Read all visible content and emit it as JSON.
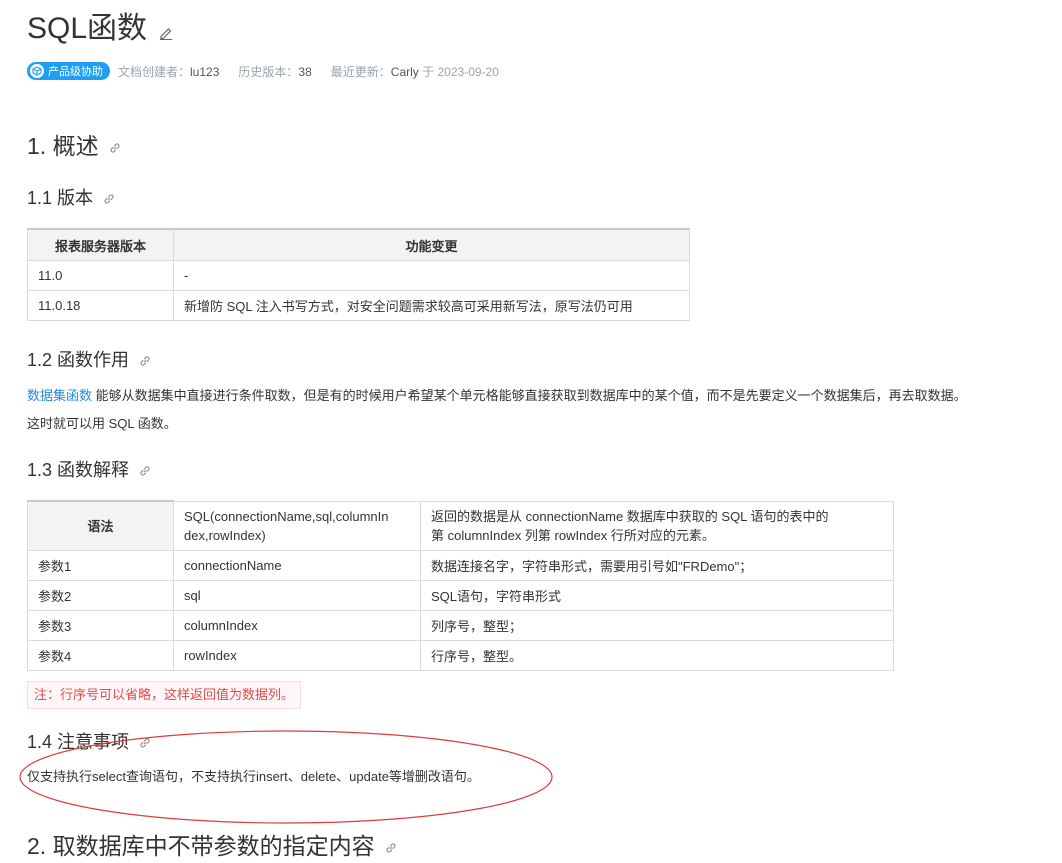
{
  "title": "SQL函数",
  "meta": {
    "badge": "产品级协助",
    "creator_label": "文档创建者：",
    "creator": "lu123",
    "versions_label": "历史版本：",
    "versions": "38",
    "updated_label": "最近更新：",
    "updated_by": "Carly",
    "updated_on_prefix": "于",
    "updated_on": "2023-09-20"
  },
  "sections": {
    "s1": "1. 概述",
    "s1_1": "1.1 版本",
    "s1_2": "1.2 函数作用",
    "s1_3": "1.3 函数解释",
    "s1_4": "1.4 注意事项",
    "s2": "2. 取数据库中不带参数的指定内容"
  },
  "version_table": {
    "headers": [
      "报表服务器版本",
      "功能变更"
    ],
    "rows": [
      [
        "11.0",
        "-"
      ],
      [
        "11.0.18",
        "新增防 SQL 注入书写方式，对安全问题需求较高可采用新写法，原写法仍可用"
      ]
    ]
  },
  "purpose": {
    "link": "数据集函数",
    "line1_rest": " 能够从数据集中直接进行条件取数，但是有的时候用户希望某个单元格能够直接获取到数据库中的某个值，而不是先要定义一个数据集后，再去取数据。",
    "line2": "这时就可以用 SQL 函数。"
  },
  "function_table": {
    "syntax_label": "语法",
    "syntax_line1": "SQL(connectionName,sql,columnIn",
    "syntax_line2": "dex,rowIndex)",
    "syntax_desc_line1": "返回的数据是从 connectionName 数据库中获取的 SQL 语句的表中的",
    "syntax_desc_line2": "第 columnIndex 列第 rowIndex 行所对应的元素。",
    "params": [
      [
        "参数1",
        "connectionName",
        "数据连接名字，字符串形式，需要用引号如\"FRDemo\"；"
      ],
      [
        "参数2",
        "sql",
        "SQL语句，字符串形式"
      ],
      [
        "参数3",
        "columnIndex",
        "列序号，整型；"
      ],
      [
        "参数4",
        "rowIndex",
        "行序号，整型。"
      ]
    ]
  },
  "note": "注：行序号可以省略，这样返回值为数据列。",
  "caution": "仅支持执行select查询语句，不支持执行insert、delete、update等增删改语句。",
  "colors": {
    "accent": "#1f9ef3",
    "link": "#1f8ce0",
    "note_text": "#e14b4b",
    "annotation": "#e03a3a"
  }
}
